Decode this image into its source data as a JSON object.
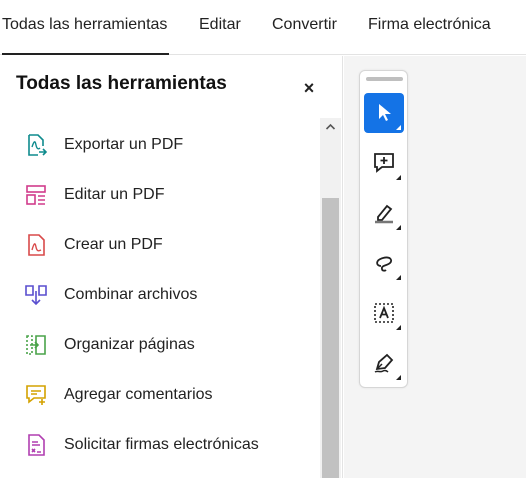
{
  "tabs": [
    {
      "label": "Todas las herramientas",
      "active": true
    },
    {
      "label": "Editar"
    },
    {
      "label": "Convertir"
    },
    {
      "label": "Firma electrónica"
    }
  ],
  "panel": {
    "title": "Todas las herramientas",
    "close_glyph": "×",
    "tools": [
      {
        "label": "Exportar un PDF",
        "icon": "export-pdf-icon",
        "color": "#0f8b8d"
      },
      {
        "label": "Editar un PDF",
        "icon": "edit-pdf-icon",
        "color": "#d13c8c"
      },
      {
        "label": "Crear un PDF",
        "icon": "create-pdf-icon",
        "color": "#d94a4a"
      },
      {
        "label": "Combinar archivos",
        "icon": "combine-files-icon",
        "color": "#5a4fcf"
      },
      {
        "label": "Organizar páginas",
        "icon": "organize-pages-icon",
        "color": "#4aa34a"
      },
      {
        "label": "Agregar comentarios",
        "icon": "add-comments-icon",
        "color": "#d4a200"
      },
      {
        "label": "Solicitar firmas electrónicas",
        "icon": "request-esign-icon",
        "color": "#b13fb1"
      }
    ]
  },
  "quick_tools": [
    {
      "icon": "select-cursor-icon",
      "selected": true
    },
    {
      "icon": "add-comment-icon"
    },
    {
      "icon": "highlight-icon"
    },
    {
      "icon": "draw-lasso-icon"
    },
    {
      "icon": "text-box-icon"
    },
    {
      "icon": "sign-pen-icon"
    }
  ],
  "colors": {
    "accent": "#1473e6"
  }
}
